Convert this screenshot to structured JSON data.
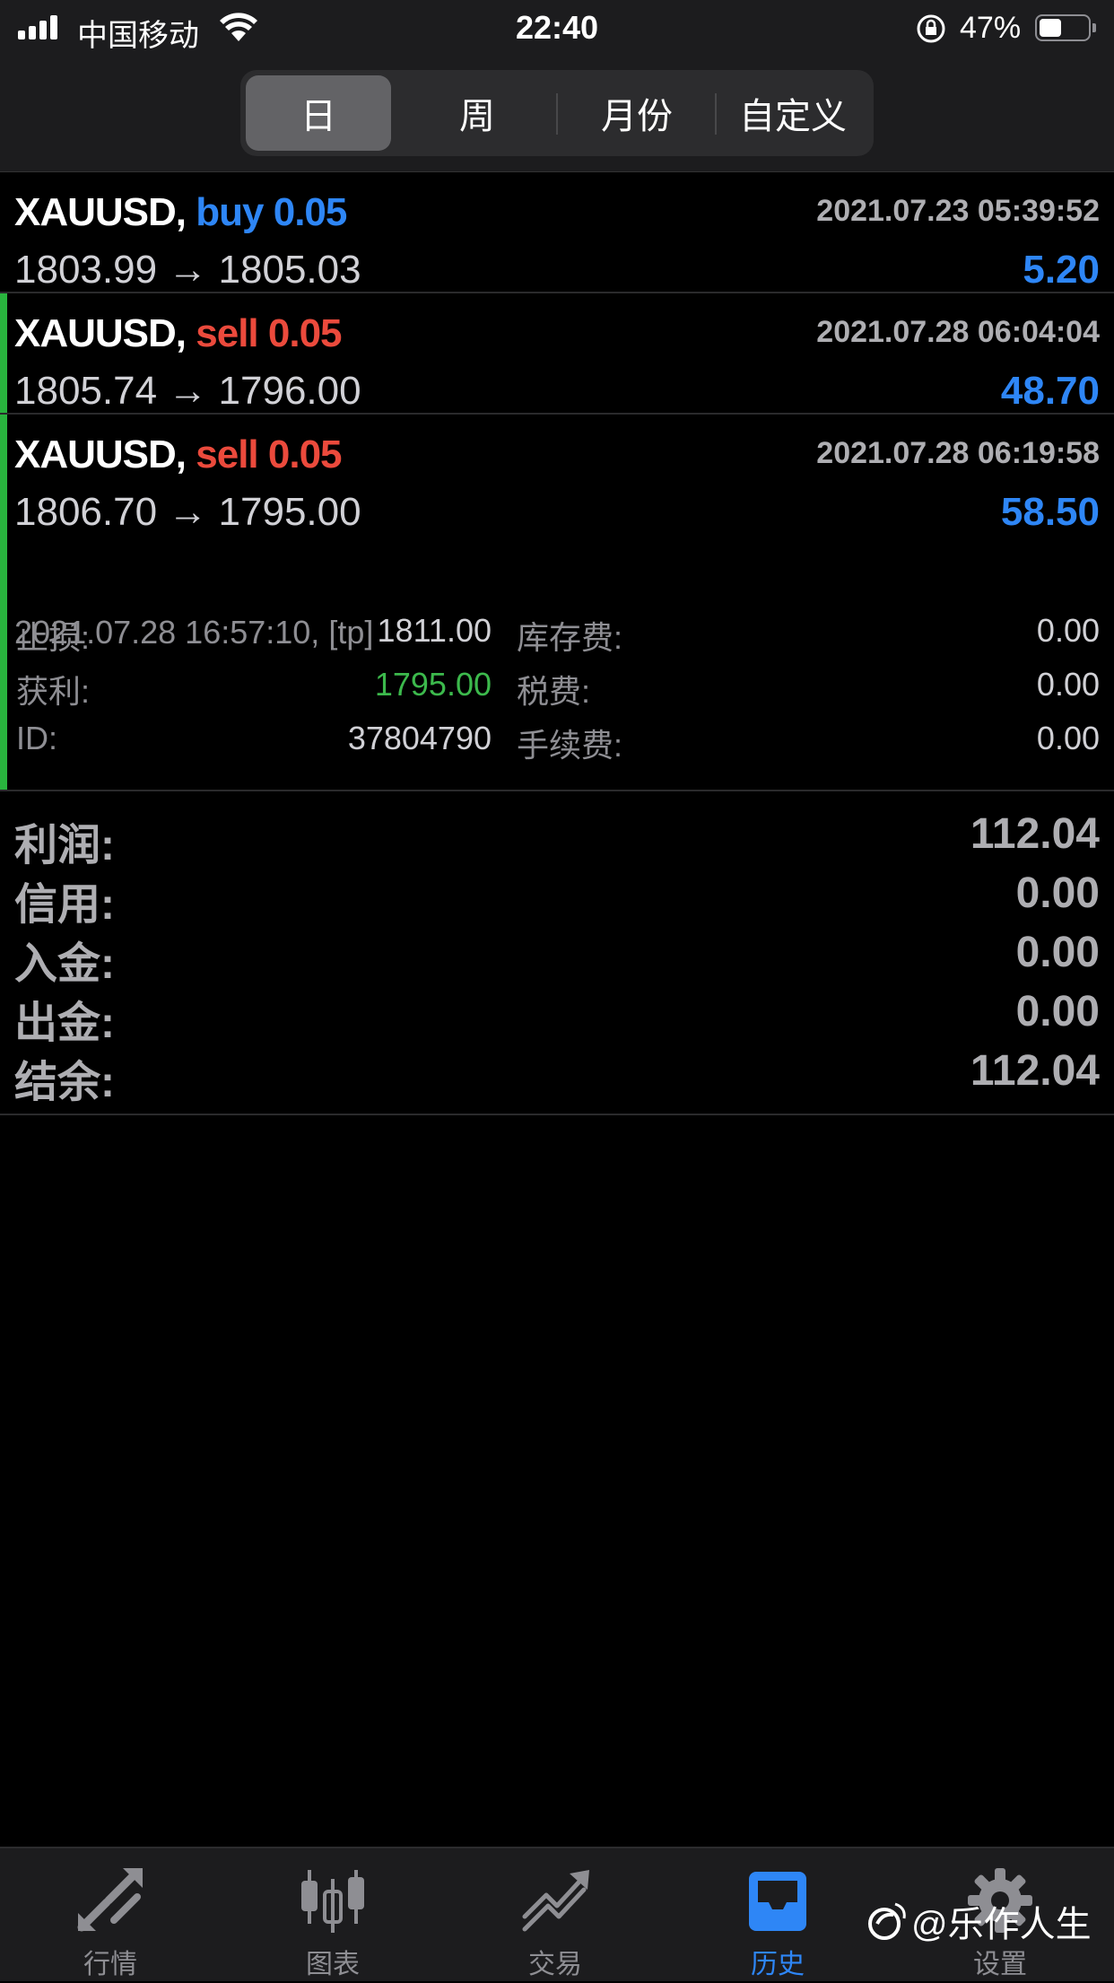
{
  "status_bar": {
    "carrier": "中国移动",
    "time": "22:40",
    "battery_percent": "47%",
    "battery_level": 0.47
  },
  "segments": [
    {
      "label": "日",
      "active": true
    },
    {
      "label": "周",
      "active": false
    },
    {
      "label": "月份",
      "active": false
    },
    {
      "label": "自定义",
      "active": false
    }
  ],
  "trades": [
    {
      "symbol": "XAUUSD,",
      "type": "buy",
      "volume": "0.05",
      "open_time": "2021.07.23 05:39:52",
      "open_price": "1803.99",
      "close_price": "1805.03",
      "arrow": "→",
      "profit": "5.20"
    },
    {
      "symbol": "XAUUSD,",
      "type": "sell",
      "volume": "0.05",
      "open_time": "2021.07.28 06:04:04",
      "open_price": "1805.74",
      "close_price": "1796.00",
      "arrow": "→",
      "profit": "48.70"
    },
    {
      "symbol": "XAUUSD,",
      "type": "sell",
      "volume": "0.05",
      "open_time": "2021.07.28 06:19:58",
      "open_price": "1806.70",
      "close_price": "1795.00",
      "arrow": "→",
      "profit": "58.50",
      "close_info": "2021.07.28 16:57:10, [tp]",
      "details": {
        "sl_label": "止损:",
        "sl_value": "1811.00",
        "tp_label": "获利:",
        "tp_value": "1795.00",
        "id_label": "ID:",
        "id_value": "37804790",
        "swap_label": "库存费:",
        "swap_value": "0.00",
        "taxes_label": "税费:",
        "taxes_value": "0.00",
        "commission_label": "手续费:",
        "commission_value": "0.00"
      }
    }
  ],
  "summary": [
    {
      "label": "利润:",
      "value": "112.04"
    },
    {
      "label": "信用:",
      "value": "0.00"
    },
    {
      "label": "入金:",
      "value": "0.00"
    },
    {
      "label": "出金:",
      "value": "0.00"
    },
    {
      "label": "结余:",
      "value": "112.04"
    }
  ],
  "tabbar": [
    {
      "label": "行情",
      "icon": "quotes-arrows-icon",
      "active": false
    },
    {
      "label": "图表",
      "icon": "candlestick-chart-icon",
      "active": false
    },
    {
      "label": "交易",
      "icon": "trade-trend-icon",
      "active": false
    },
    {
      "label": "历史",
      "icon": "history-inbox-icon",
      "active": true
    },
    {
      "label": "设置",
      "icon": "gear-icon",
      "active": false
    }
  ],
  "watermark": "@乐作人生",
  "colors": {
    "buy": "#2e86f6",
    "sell": "#eb4a3c",
    "profit": "#2e86f6",
    "take_profit": "#3cb94c",
    "accent_bar": "#29b43e",
    "active_tab": "#2e86f6"
  }
}
